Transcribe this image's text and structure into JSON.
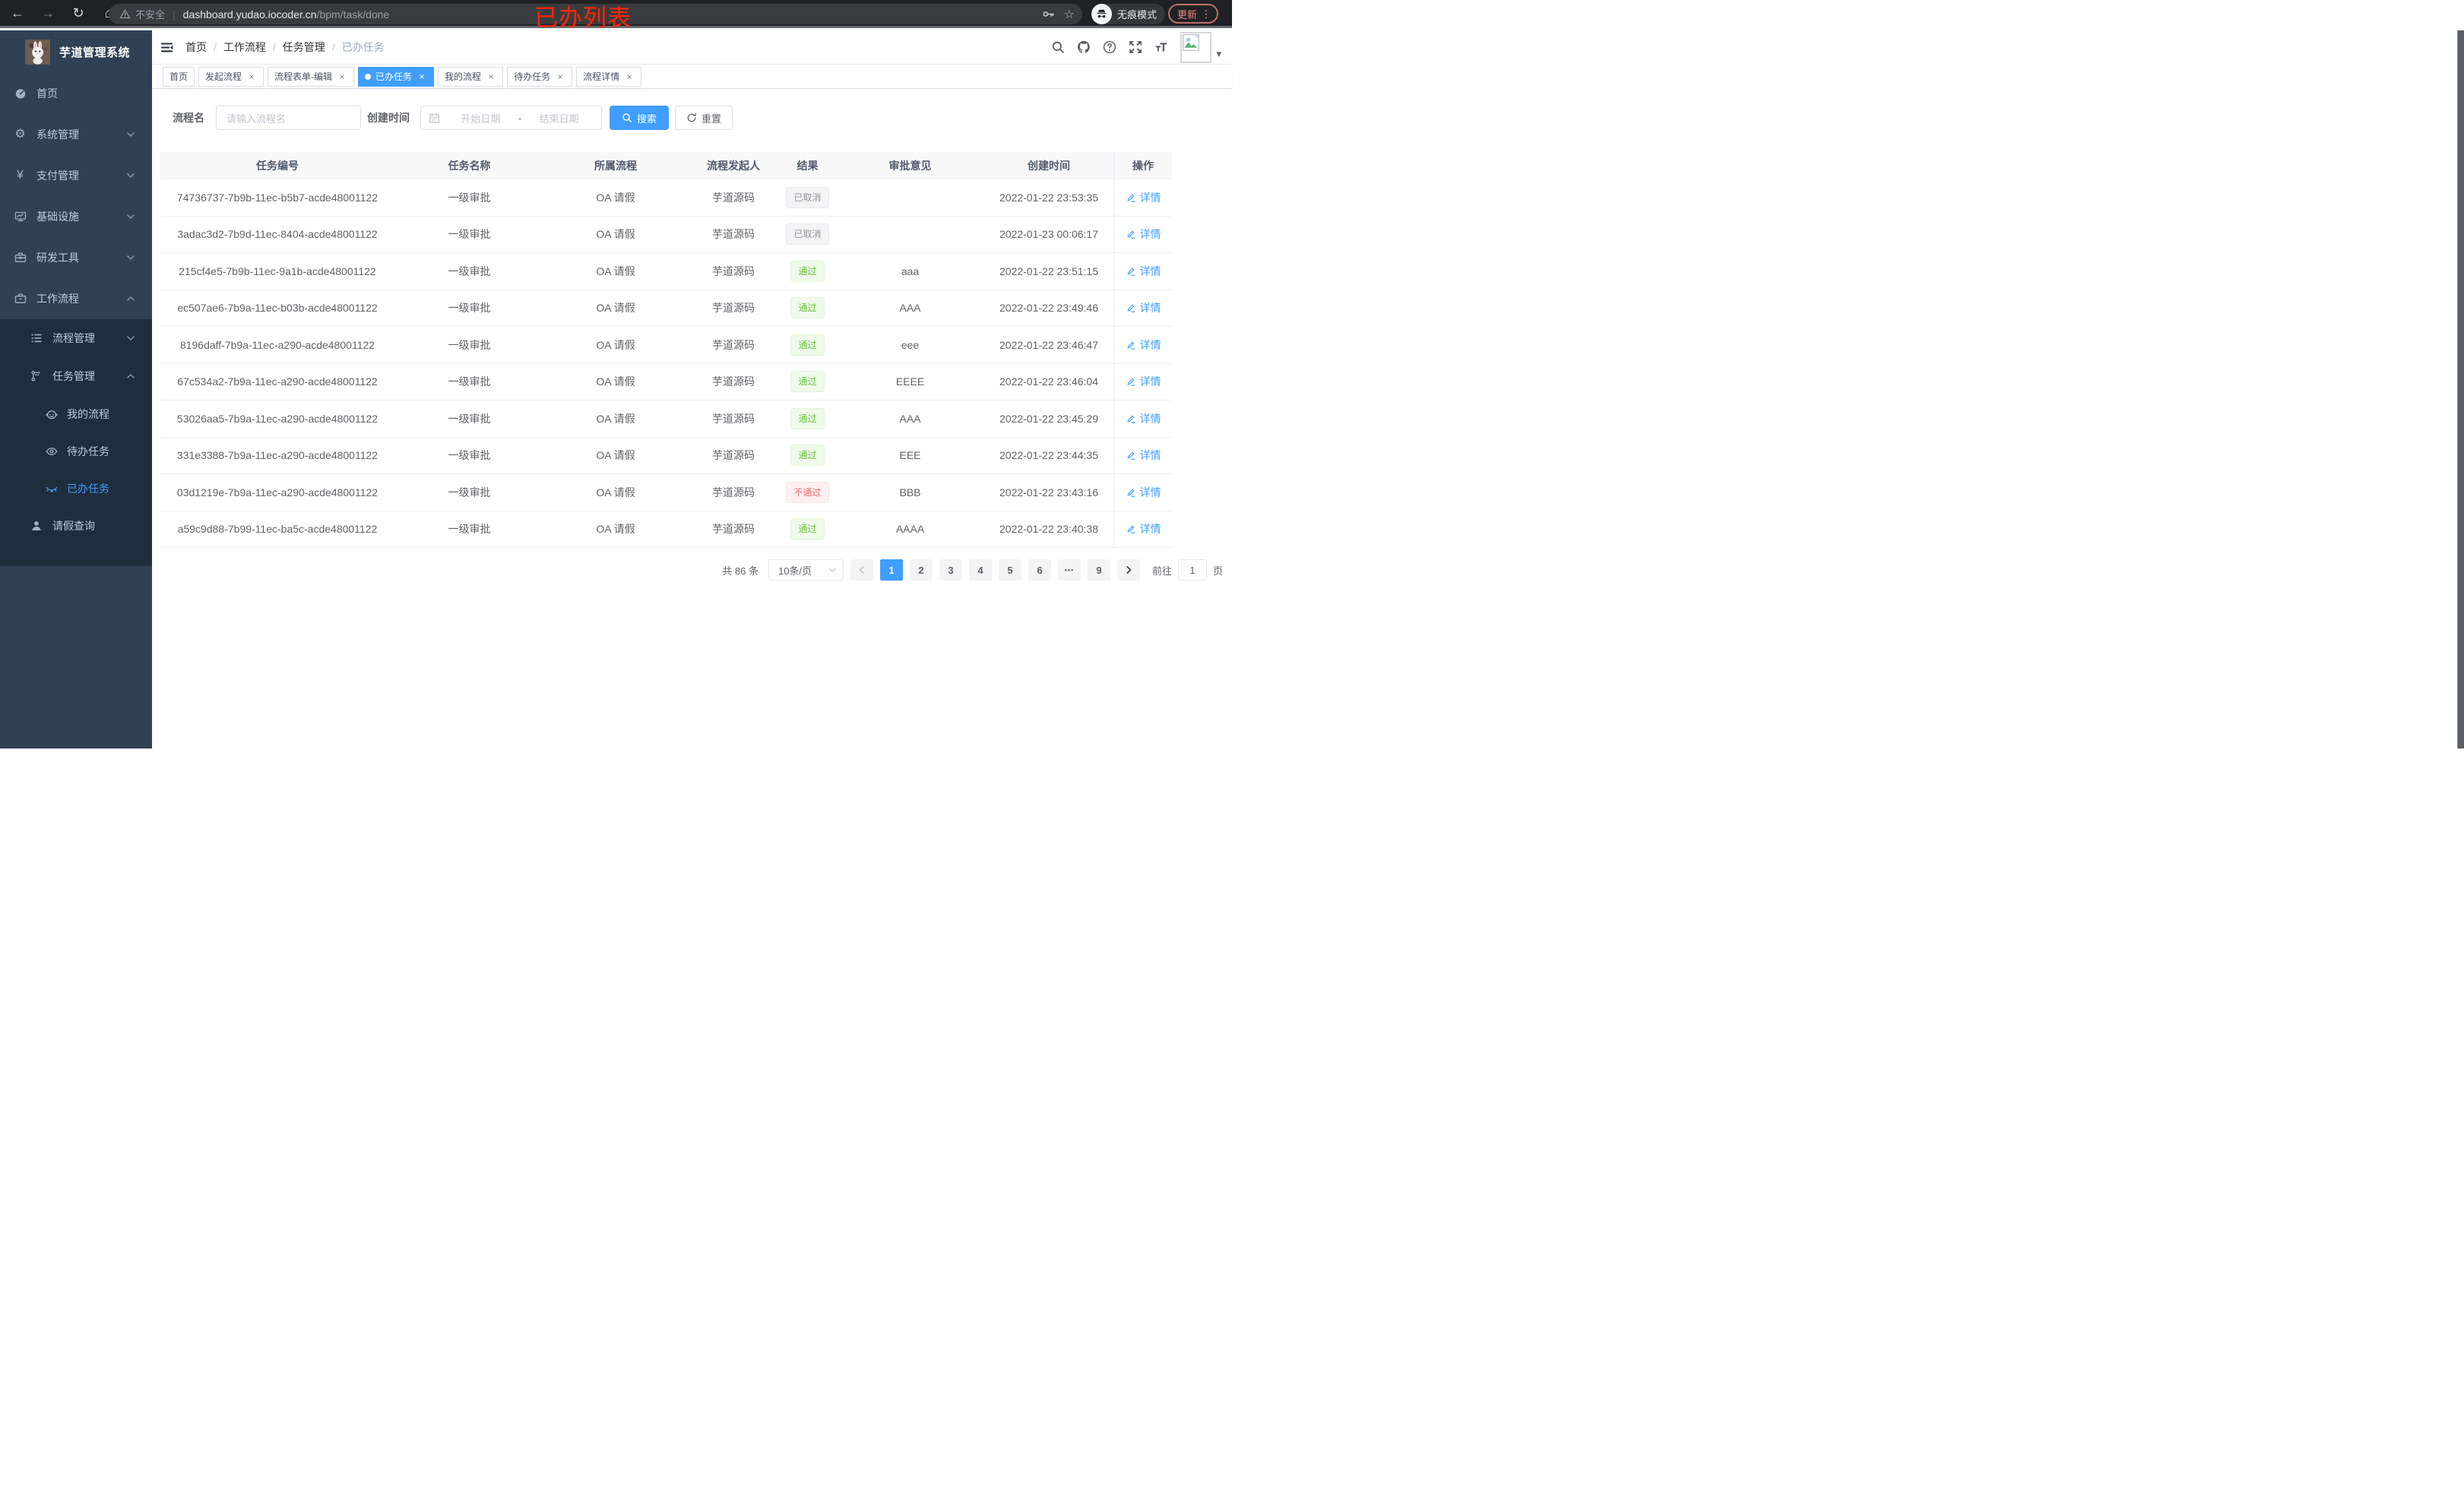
{
  "browser": {
    "security_label": "不安全",
    "url_host": "dashboard.yudao.iocoder.cn",
    "url_path": "/bpm/task/done",
    "annotation": "已办列表",
    "incognito_label": "无痕模式",
    "update_label": "更新"
  },
  "icons": {
    "back-icon": "←",
    "forward-icon": "→",
    "reload-icon": "↻",
    "home-icon": "⌂",
    "star-icon": "☆",
    "kebab-icon": "⋮",
    "caret-down-icon": "▾",
    "url-separator": "|",
    "gear-icon": "⚙",
    "yen-icon": "¥",
    "close-icon": "×",
    "ellipsis-icon": "•••"
  },
  "sidebar": {
    "app_title": "芋道管理系统",
    "items": [
      {
        "label": "首页",
        "icon": "dashboard-icon",
        "depth": 0,
        "group": "root"
      },
      {
        "label": "系统管理",
        "icon": "gear-icon",
        "depth": 0,
        "chevron": "down",
        "group": "root"
      },
      {
        "label": "支付管理",
        "icon": "yen-icon",
        "depth": 0,
        "chevron": "down",
        "group": "root"
      },
      {
        "label": "基础设施",
        "icon": "monitor-icon",
        "depth": 0,
        "chevron": "down",
        "group": "root"
      },
      {
        "label": "研发工具",
        "icon": "toolbox-icon",
        "depth": 0,
        "chevron": "down",
        "group": "root"
      },
      {
        "label": "工作流程",
        "icon": "briefcase-icon",
        "depth": 0,
        "chevron": "up",
        "group": "root"
      },
      {
        "label": "流程管理",
        "icon": "list-tree-icon",
        "depth": 1,
        "chevron": "down",
        "group": "sub"
      },
      {
        "label": "任务管理",
        "icon": "org-tree-icon",
        "depth": 1,
        "chevron": "up",
        "group": "sub"
      },
      {
        "label": "我的流程",
        "icon": "robot-icon",
        "depth": 2,
        "group": "sub"
      },
      {
        "label": "待办任务",
        "icon": "eye-icon",
        "depth": 2,
        "group": "sub"
      },
      {
        "label": "已办任务",
        "icon": "eye-closed-icon",
        "depth": 2,
        "group": "sub",
        "active": true
      },
      {
        "label": "请假查询",
        "icon": "user-icon",
        "depth": 1,
        "group": "sub"
      }
    ]
  },
  "breadcrumb": [
    "首页",
    "工作流程",
    "任务管理",
    "已办任务"
  ],
  "tabs": [
    {
      "label": "首页",
      "closable": false,
      "active": false
    },
    {
      "label": "发起流程",
      "closable": true,
      "active": false
    },
    {
      "label": "流程表单-编辑",
      "closable": true,
      "active": false
    },
    {
      "label": "已办任务",
      "closable": true,
      "active": true
    },
    {
      "label": "我的流程",
      "closable": true,
      "active": false
    },
    {
      "label": "待办任务",
      "closable": true,
      "active": false
    },
    {
      "label": "流程详情",
      "closable": true,
      "active": false
    }
  ],
  "search": {
    "name_label": "流程名",
    "name_placeholder": "请输入流程名",
    "date_label": "创建时间",
    "date_start_placeholder": "开始日期",
    "date_separator": "-",
    "date_end_placeholder": "结束日期",
    "search_label": "搜索",
    "reset_label": "重置"
  },
  "table": {
    "columns": [
      "任务编号",
      "任务名称",
      "所属流程",
      "流程发起人",
      "结果",
      "审批意见",
      "创建时间",
      "操作"
    ],
    "detail_label": "详情",
    "rows": [
      {
        "id": "74736737-7b9b-11ec-b5b7-acde48001122",
        "name": "一级审批",
        "process": "OA 请假",
        "starter": "芋道源码",
        "result": "已取消",
        "result_type": "info",
        "opinion": "",
        "created": "2022-01-22 23:53:35"
      },
      {
        "id": "3adac3d2-7b9d-11ec-8404-acde48001122",
        "name": "一级审批",
        "process": "OA 请假",
        "starter": "芋道源码",
        "result": "已取消",
        "result_type": "info",
        "opinion": "",
        "created": "2022-01-23 00:06:17"
      },
      {
        "id": "215cf4e5-7b9b-11ec-9a1b-acde48001122",
        "name": "一级审批",
        "process": "OA 请假",
        "starter": "芋道源码",
        "result": "通过",
        "result_type": "success",
        "opinion": "aaa",
        "created": "2022-01-22 23:51:15"
      },
      {
        "id": "ec507ae6-7b9a-11ec-b03b-acde48001122",
        "name": "一级审批",
        "process": "OA 请假",
        "starter": "芋道源码",
        "result": "通过",
        "result_type": "success",
        "opinion": "AAA",
        "created": "2022-01-22 23:49:46"
      },
      {
        "id": "8196daff-7b9a-11ec-a290-acde48001122",
        "name": "一级审批",
        "process": "OA 请假",
        "starter": "芋道源码",
        "result": "通过",
        "result_type": "success",
        "opinion": "eee",
        "created": "2022-01-22 23:46:47"
      },
      {
        "id": "67c534a2-7b9a-11ec-a290-acde48001122",
        "name": "一级审批",
        "process": "OA 请假",
        "starter": "芋道源码",
        "result": "通过",
        "result_type": "success",
        "opinion": "EEEE",
        "created": "2022-01-22 23:46:04"
      },
      {
        "id": "53026aa5-7b9a-11ec-a290-acde48001122",
        "name": "一级审批",
        "process": "OA 请假",
        "starter": "芋道源码",
        "result": "通过",
        "result_type": "success",
        "opinion": "AAA",
        "created": "2022-01-22 23:45:29"
      },
      {
        "id": "331e3388-7b9a-11ec-a290-acde48001122",
        "name": "一级审批",
        "process": "OA 请假",
        "starter": "芋道源码",
        "result": "通过",
        "result_type": "success",
        "opinion": "EEE",
        "created": "2022-01-22 23:44:35"
      },
      {
        "id": "03d1219e-7b9a-11ec-a290-acde48001122",
        "name": "一级审批",
        "process": "OA 请假",
        "starter": "芋道源码",
        "result": "不通过",
        "result_type": "danger",
        "opinion": "BBB",
        "created": "2022-01-22 23:43:16"
      },
      {
        "id": "a59c9d88-7b99-11ec-ba5c-acde48001122",
        "name": "一级审批",
        "process": "OA 请假",
        "starter": "芋道源码",
        "result": "通过",
        "result_type": "success",
        "opinion": "AAAA",
        "created": "2022-01-22 23:40:38"
      }
    ]
  },
  "pagination": {
    "total_text": "共 86 条",
    "page_size": "10条/页",
    "pages": [
      "1",
      "2",
      "3",
      "4",
      "5",
      "6",
      "...",
      "9"
    ],
    "active_page": "1",
    "goto_label": "前往",
    "goto_value": "1",
    "page_unit_label": "页"
  },
  "colors": {
    "accent": "#409EFF",
    "sidebar_bg": "#304156",
    "submenu_bg": "#1f2d3d",
    "success": "#67C23A",
    "danger": "#F56C6C",
    "info": "#909399",
    "annotation_red": "#ff2501"
  }
}
